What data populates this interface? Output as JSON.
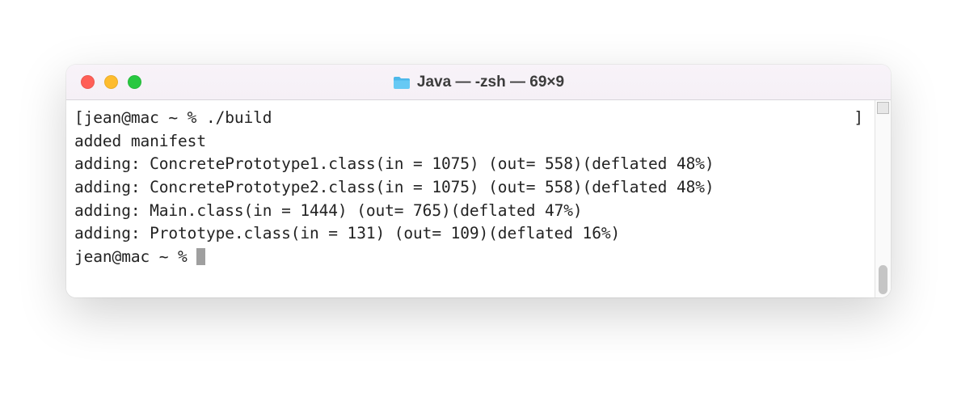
{
  "window": {
    "title": "Java — -zsh — 69×9"
  },
  "terminal": {
    "prompt1_open": "[",
    "prompt1_body": "jean@mac ~ % ./build",
    "prompt1_close": "]",
    "lines": [
      "added manifest",
      "adding: ConcretePrototype1.class(in = 1075) (out= 558)(deflated 48%)",
      "adding: ConcretePrototype2.class(in = 1075) (out= 558)(deflated 48%)",
      "adding: Main.class(in = 1444) (out= 765)(deflated 47%)",
      "adding: Prototype.class(in = 131) (out= 109)(deflated 16%)"
    ],
    "prompt2": "jean@mac ~ % "
  }
}
